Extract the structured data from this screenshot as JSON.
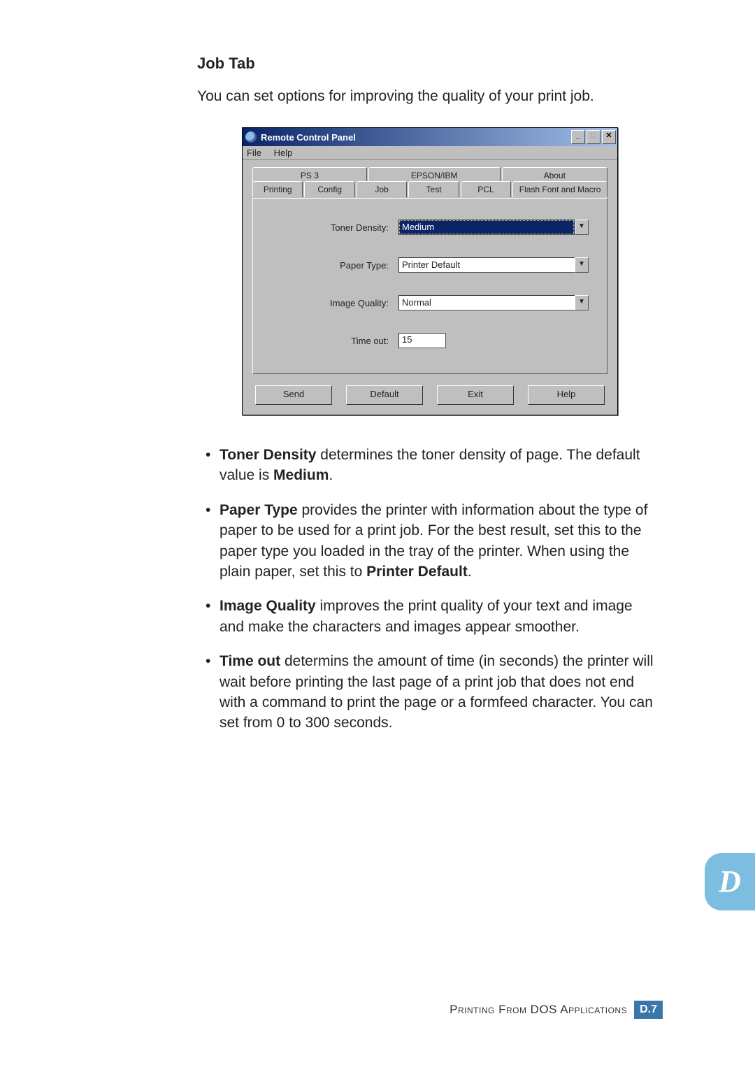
{
  "heading": "Job Tab",
  "intro": "You can set options for improving the quality of your print job.",
  "window": {
    "title": "Remote Control Panel",
    "menu": {
      "file": "File",
      "help": "Help"
    },
    "win_buttons": {
      "min": "_",
      "max": "□",
      "close": "✕"
    },
    "tabs_back": [
      "PS 3",
      "EPSON/IBM",
      "About"
    ],
    "tabs_front": [
      "Printing",
      "Config",
      "Job",
      "Test",
      "PCL",
      "Flash Font and Macro"
    ],
    "active_tab": "Job",
    "fields": {
      "toner_density": {
        "label": "Toner Density:",
        "value": "Medium"
      },
      "paper_type": {
        "label": "Paper Type:",
        "value": "Printer Default"
      },
      "image_quality": {
        "label": "Image Quality:",
        "value": "Normal"
      },
      "time_out": {
        "label": "Time out:",
        "value": "15"
      }
    },
    "buttons": {
      "send": "Send",
      "default": "Default",
      "exit": "Exit",
      "help": "Help"
    }
  },
  "bullets": {
    "b1_lead": "Toner Density",
    "b1_rest": " determines the toner density of page. The default value is ",
    "b1_bold2": "Medium",
    "b1_tail": ".",
    "b2_lead": "Paper Type",
    "b2_rest": " provides the printer with information about the type of paper to be used for a print job. For the best result, set this to the paper type you loaded in the tray of the printer. When using the plain paper, set this to ",
    "b2_bold2": "Printer Default",
    "b2_tail": ".",
    "b3_lead": "Image Quality",
    "b3_rest": " improves the print quality of your text and image and make the characters and images appear smoother.",
    "b4_lead": "Time out",
    "b4_rest": " determins the amount of time (in seconds) the printer will wait before printing the last page of a print job that does not end with a command to print the page or a formfeed character. You can set from 0 to 300 seconds."
  },
  "appendix_letter": "D",
  "footer": {
    "text_caps": "Printing From DOS Applications",
    "page_letter": "D.",
    "page_num": "7"
  }
}
